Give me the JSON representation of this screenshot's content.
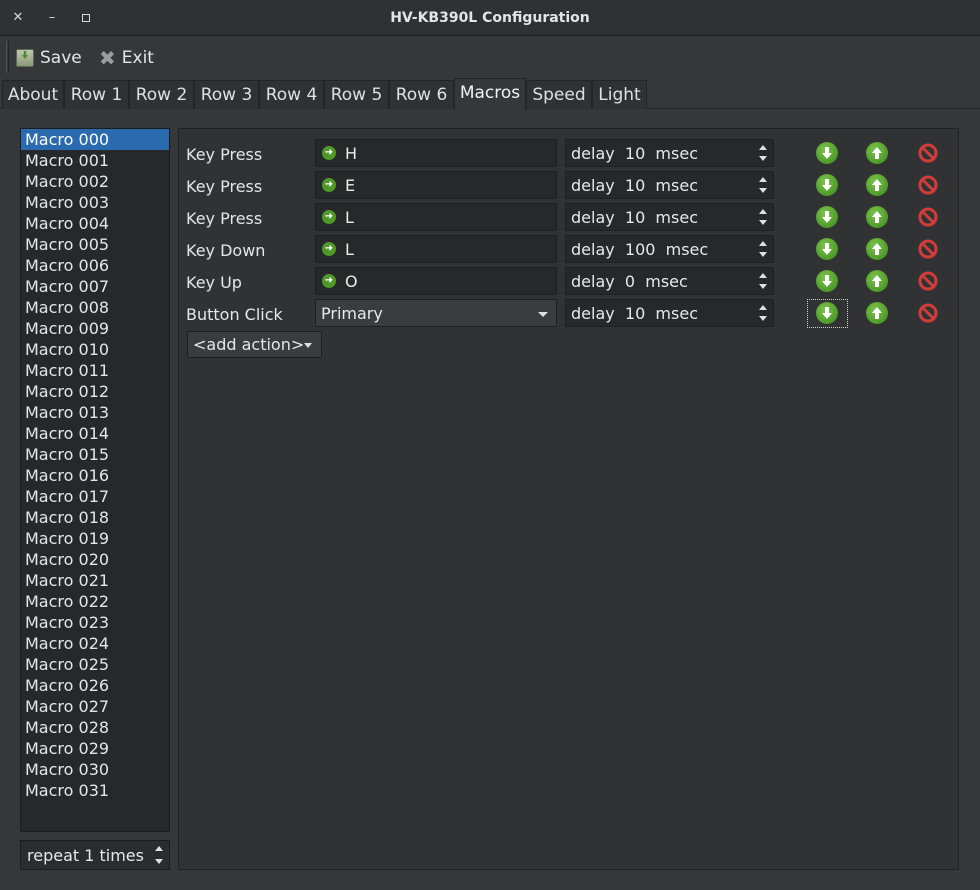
{
  "window": {
    "title": "HV-KB390L Configuration"
  },
  "toolbar": {
    "save_label": "Save",
    "exit_label": "Exit"
  },
  "tabs": [
    {
      "label": "About"
    },
    {
      "label": "Row 1"
    },
    {
      "label": "Row 2"
    },
    {
      "label": "Row 3"
    },
    {
      "label": "Row 4"
    },
    {
      "label": "Row 5"
    },
    {
      "label": "Row 6"
    },
    {
      "label": "Macros",
      "active": true
    },
    {
      "label": "Speed"
    },
    {
      "label": "Light"
    }
  ],
  "macros": [
    "Macro 000",
    "Macro 001",
    "Macro 002",
    "Macro 003",
    "Macro 004",
    "Macro 005",
    "Macro 006",
    "Macro 007",
    "Macro 008",
    "Macro 009",
    "Macro 010",
    "Macro 011",
    "Macro 012",
    "Macro 013",
    "Macro 014",
    "Macro 015",
    "Macro 016",
    "Macro 017",
    "Macro 018",
    "Macro 019",
    "Macro 020",
    "Macro 021",
    "Macro 022",
    "Macro 023",
    "Macro 024",
    "Macro 025",
    "Macro 026",
    "Macro 027",
    "Macro 028",
    "Macro 029",
    "Macro 030",
    "Macro 031"
  ],
  "selected_macro": "Macro 000",
  "repeat": {
    "text": "repeat  1  times"
  },
  "actions": [
    {
      "type": "Key Press",
      "value": "H",
      "delay": "delay  10  msec"
    },
    {
      "type": "Key Press",
      "value": "E",
      "delay": "delay  10  msec"
    },
    {
      "type": "Key Press",
      "value": "L",
      "delay": "delay  10  msec"
    },
    {
      "type": "Key Down",
      "value": "L",
      "delay": "delay  100  msec"
    },
    {
      "type": "Key Up",
      "value": "O",
      "delay": "delay  0  msec"
    },
    {
      "type": "Button Click",
      "value": "Primary",
      "delay": "delay  10  msec"
    }
  ],
  "add_action_label": "<add action>",
  "colors": {
    "accent": "#2a6bb0",
    "green_icon": "#4f9a2a",
    "remove_icon": "#d63b3b"
  }
}
